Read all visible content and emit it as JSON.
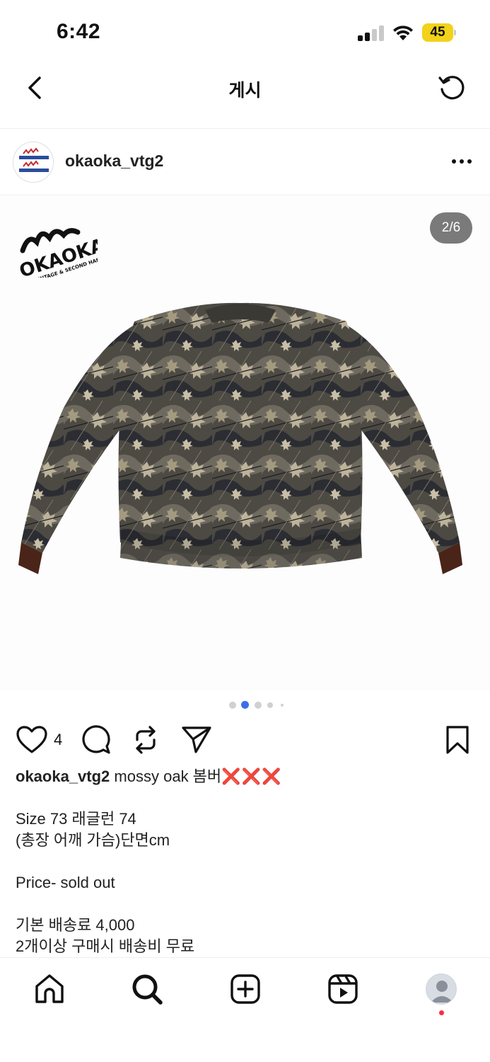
{
  "status_bar": {
    "time": "6:42",
    "battery": "45"
  },
  "header": {
    "title": "게시"
  },
  "post": {
    "username": "okaoka_vtg2",
    "image_counter": "2/6",
    "brand_logo_text": "OKAOKA",
    "brand_logo_subtext": "VINTAGE & SECOND HANDS",
    "likes": "4",
    "carousel_active_index": 2,
    "carousel_total_dots": 5
  },
  "caption": {
    "username": "okaoka_vtg2",
    "title_text": "mossy oak  봄버",
    "title_marks": "❌❌❌",
    "line_size": "Size 73 래글런 74",
    "line_measure": "(총장 어깨 가슴)단면cm",
    "line_price": "Price- sold out",
    "line_shipping": "기본 배송료 4,000",
    "line_free": "2개이상 구매시 배송비 무료"
  },
  "colors": {
    "accent_blue": "#3d6ee8",
    "battery_yellow": "#f2d21a",
    "notification_red": "#ff2a45"
  },
  "icons": {
    "back": "chevron-left-icon",
    "refresh": "refresh-icon",
    "more": "more-horizontal-icon",
    "like": "heart-icon",
    "comment": "comment-icon",
    "repost": "repost-icon",
    "share": "send-icon",
    "save": "bookmark-icon",
    "nav": [
      "home-icon",
      "search-icon",
      "add-icon",
      "reels-icon",
      "profile-icon"
    ]
  }
}
